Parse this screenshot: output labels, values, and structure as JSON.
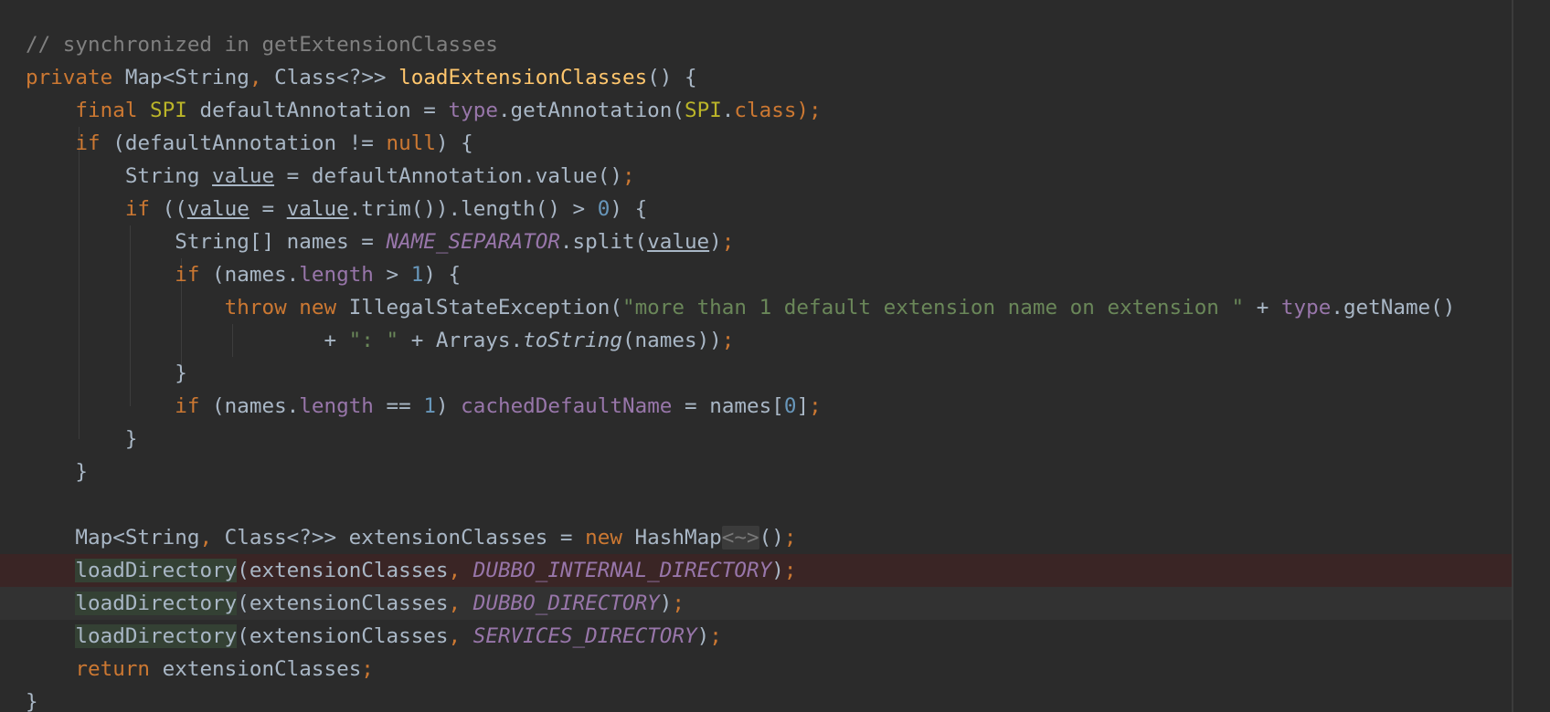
{
  "colors": {
    "background": "#2b2b2b",
    "keyword": "#cc7832",
    "method_declaration": "#ffc66d",
    "annotation": "#bbb529",
    "field": "#9876aa",
    "number": "#6897bb",
    "string": "#6a8759",
    "comment": "#808080",
    "plain": "#a9b7c6",
    "error_line": "#3a2525"
  },
  "editor": {
    "lines": [
      {
        "name": "line-comment",
        "style": "",
        "tokens": [
          [
            "// synchronized in getExtensionClasses",
            "cm"
          ]
        ]
      },
      {
        "name": "line-method-signature",
        "style": "",
        "tokens": [
          [
            "private",
            "kw"
          ],
          [
            " ",
            "pl"
          ],
          [
            "Map",
            "ty"
          ],
          [
            "<",
            "pl"
          ],
          [
            "String",
            "ty"
          ],
          [
            ", ",
            "pu"
          ],
          [
            "Class",
            "ty"
          ],
          [
            "<?>> ",
            "pl"
          ],
          [
            "loadExtensionClasses",
            "fn"
          ],
          [
            "() {",
            "pl"
          ]
        ]
      },
      {
        "name": "line-default-annotation",
        "style": "",
        "tokens": [
          [
            "    ",
            "pl"
          ],
          [
            "final",
            "kw"
          ],
          [
            " ",
            "pl"
          ],
          [
            "SPI",
            "ann"
          ],
          [
            " defaultAnnotation = ",
            "pl"
          ],
          [
            "type",
            "fld"
          ],
          [
            ".getAnnotation(",
            "pl"
          ],
          [
            "SPI",
            "ann"
          ],
          [
            ".",
            "pl"
          ],
          [
            "class",
            "kw"
          ],
          [
            ");",
            "pu"
          ]
        ]
      },
      {
        "name": "line-if-not-null",
        "style": "",
        "tokens": [
          [
            "    ",
            "pl"
          ],
          [
            "if",
            "kw"
          ],
          [
            " (defaultAnnotation != ",
            "pl"
          ],
          [
            "null",
            "kw"
          ],
          [
            ") {",
            "pl"
          ]
        ]
      },
      {
        "name": "line-string-value",
        "style": "",
        "tokens": [
          [
            "        String ",
            "pl"
          ],
          [
            "value",
            "ul"
          ],
          [
            " = defaultAnnotation.value()",
            "pl"
          ],
          [
            ";",
            "pu"
          ]
        ]
      },
      {
        "name": "line-if-trim-length",
        "style": "",
        "tokens": [
          [
            "        ",
            "pl"
          ],
          [
            "if",
            "kw"
          ],
          [
            " ((",
            "pl"
          ],
          [
            "value",
            "ul"
          ],
          [
            " = ",
            "pl"
          ],
          [
            "value",
            "ul"
          ],
          [
            ".trim()).length() > ",
            "pl"
          ],
          [
            "0",
            "num"
          ],
          [
            ") {",
            "pl"
          ]
        ]
      },
      {
        "name": "line-names-split",
        "style": "",
        "tokens": [
          [
            "            String[] names = ",
            "pl"
          ],
          [
            "NAME_SEPARATOR",
            "cst"
          ],
          [
            ".split(",
            "pl"
          ],
          [
            "value",
            "ul"
          ],
          [
            ")",
            "pl"
          ],
          [
            ";",
            "pu"
          ]
        ]
      },
      {
        "name": "line-if-names-length",
        "style": "",
        "tokens": [
          [
            "            ",
            "pl"
          ],
          [
            "if",
            "kw"
          ],
          [
            " (names.",
            "pl"
          ],
          [
            "length",
            "fld"
          ],
          [
            " > ",
            "pl"
          ],
          [
            "1",
            "num"
          ],
          [
            ") {",
            "pl"
          ]
        ]
      },
      {
        "name": "line-throw",
        "style": "",
        "tokens": [
          [
            "                ",
            "pl"
          ],
          [
            "throw",
            "kw"
          ],
          [
            " ",
            "pl"
          ],
          [
            "new",
            "kw"
          ],
          [
            " IllegalStateException(",
            "pl"
          ],
          [
            "\"more than 1 default extension name on extension \"",
            "str"
          ],
          [
            " + ",
            "pl"
          ],
          [
            "type",
            "fld"
          ],
          [
            ".getName()",
            "pl"
          ]
        ]
      },
      {
        "name": "line-throw-continuation",
        "style": "",
        "tokens": [
          [
            "                        + ",
            "pl"
          ],
          [
            "\": \"",
            "str"
          ],
          [
            " + Arrays.",
            "pl"
          ],
          [
            "toString",
            "it"
          ],
          [
            "(names))",
            "pl"
          ],
          [
            ";",
            "pu"
          ]
        ]
      },
      {
        "name": "line-close-if-names",
        "style": "",
        "tokens": [
          [
            "            }",
            "pl"
          ]
        ]
      },
      {
        "name": "line-cached-default-name",
        "style": "",
        "tokens": [
          [
            "            ",
            "pl"
          ],
          [
            "if",
            "kw"
          ],
          [
            " (names.",
            "pl"
          ],
          [
            "length",
            "fld"
          ],
          [
            " == ",
            "pl"
          ],
          [
            "1",
            "num"
          ],
          [
            ") ",
            "pl"
          ],
          [
            "cachedDefaultName",
            "fld"
          ],
          [
            " = names[",
            "pl"
          ],
          [
            "0",
            "num"
          ],
          [
            "]",
            "pl"
          ],
          [
            ";",
            "pu"
          ]
        ]
      },
      {
        "name": "line-close-if-trim",
        "style": "",
        "tokens": [
          [
            "        }",
            "pl"
          ]
        ]
      },
      {
        "name": "line-close-if-not-null",
        "style": "",
        "tokens": [
          [
            "    }",
            "pl"
          ]
        ]
      },
      {
        "name": "line-blank",
        "style": "",
        "tokens": [
          [
            "",
            "pl"
          ]
        ]
      },
      {
        "name": "line-extension-classes",
        "style": "",
        "tokens": [
          [
            "    Map<String",
            "pl"
          ],
          [
            ", ",
            "pu"
          ],
          [
            "Class<?>> extensionClasses = ",
            "pl"
          ],
          [
            "new",
            "kw"
          ],
          [
            " HashMap",
            "pl"
          ],
          [
            "<~>",
            "hint"
          ],
          [
            "()",
            "pl"
          ],
          [
            ";",
            "pu"
          ]
        ]
      },
      {
        "name": "line-load-internal-directory",
        "style": "error",
        "tokens": [
          [
            "    ",
            "pl"
          ],
          [
            "loadDirectory",
            "mhl"
          ],
          [
            "(extensionClasses",
            "pl"
          ],
          [
            ", ",
            "pu"
          ],
          [
            "DUBBO_INTERNAL_DIRECTORY",
            "cst"
          ],
          [
            ")",
            "pl"
          ],
          [
            ";",
            "pu"
          ]
        ]
      },
      {
        "name": "line-load-dubbo-directory",
        "style": "caret",
        "tokens": [
          [
            "    ",
            "pl"
          ],
          [
            "loadDirectory",
            "mhl"
          ],
          [
            "(extensionClasses",
            "pl"
          ],
          [
            ", ",
            "pu"
          ],
          [
            "DUBBO_DIRECTORY",
            "cst"
          ],
          [
            ")",
            "pl"
          ],
          [
            ";",
            "pu"
          ]
        ]
      },
      {
        "name": "line-load-services-directory",
        "style": "",
        "tokens": [
          [
            "    ",
            "pl"
          ],
          [
            "loadDirectory",
            "mhl"
          ],
          [
            "(extensionClasses",
            "pl"
          ],
          [
            ", ",
            "pu"
          ],
          [
            "SERVICES_DIRECTORY",
            "cst"
          ],
          [
            ")",
            "pl"
          ],
          [
            ";",
            "pu"
          ]
        ]
      },
      {
        "name": "line-return",
        "style": "",
        "tokens": [
          [
            "    ",
            "pl"
          ],
          [
            "return",
            "kw"
          ],
          [
            " extensionClasses",
            "pl"
          ],
          [
            ";",
            "pu"
          ]
        ]
      },
      {
        "name": "line-close-method",
        "style": "",
        "tokens": [
          [
            "}",
            "pl"
          ]
        ]
      }
    ]
  }
}
